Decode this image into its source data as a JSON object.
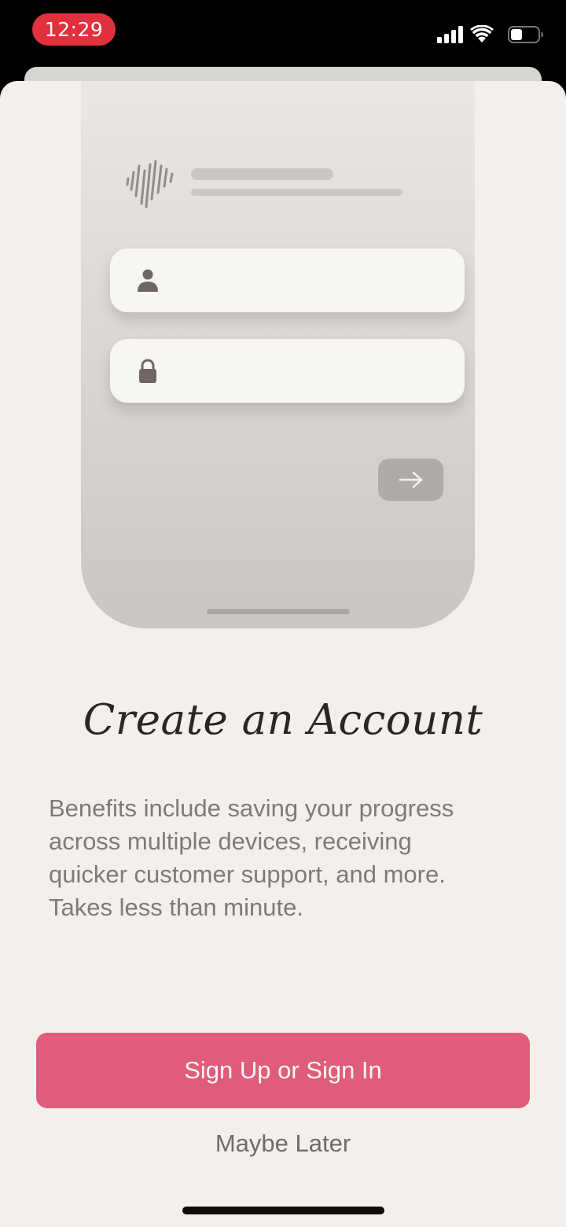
{
  "status_bar": {
    "time": "12:29",
    "icons": [
      "signal-icon",
      "wifi-icon",
      "battery-icon"
    ],
    "time_pill_color": "#e0313d",
    "battery_level": 0.35
  },
  "illustration": {
    "fields": [
      "user-icon",
      "lock-icon"
    ],
    "submit_icon": "arrow-right-icon"
  },
  "content": {
    "title": "Create an Account",
    "description": "Benefits include saving your progress across multiple devices, receiving quicker customer support, and more. Takes less than minute."
  },
  "actions": {
    "primary_label": "Sign Up or Sign In",
    "secondary_label": "Maybe Later",
    "primary_color": "#df5c7a"
  }
}
